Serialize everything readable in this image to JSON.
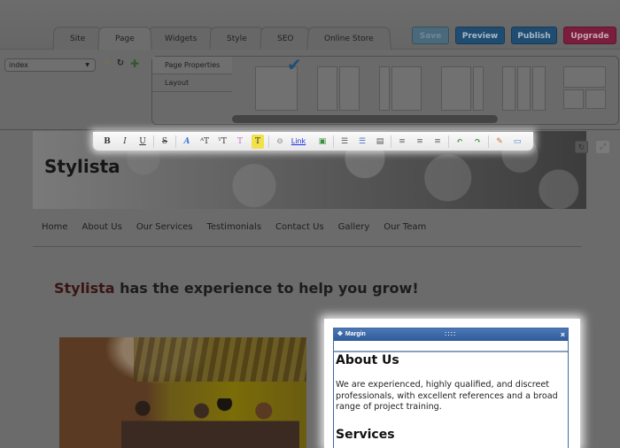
{
  "editor": {
    "tabs": [
      {
        "label": "Site",
        "active": false
      },
      {
        "label": "Page",
        "active": true
      },
      {
        "label": "Widgets",
        "active": false
      },
      {
        "label": "Style",
        "active": false
      },
      {
        "label": "SEO",
        "active": false
      },
      {
        "label": "Online Store",
        "active": false
      }
    ],
    "buttons": {
      "save": "Save",
      "preview": "Preview",
      "publish": "Publish",
      "upgrade": "Upgrade"
    },
    "page_select": {
      "value": "index"
    },
    "page_tools": [
      "pencil-icon",
      "refresh-icon",
      "add-page-icon"
    ],
    "properties_menu": [
      {
        "label": "Page Properties",
        "active": true
      },
      {
        "label": "Layout",
        "active": false
      }
    ],
    "layouts": [
      {
        "name": "single-column",
        "selected": true
      },
      {
        "name": "two-equal-columns",
        "selected": false
      },
      {
        "name": "narrow-left-wide-right",
        "selected": false
      },
      {
        "name": "wide-left-narrow-right",
        "selected": false
      },
      {
        "name": "three-columns",
        "selected": false
      },
      {
        "name": "header-two-columns",
        "selected": false
      }
    ]
  },
  "format_toolbar": {
    "groups": [
      [
        {
          "name": "bold",
          "glyph": "B"
        },
        {
          "name": "italic",
          "glyph": "I"
        },
        {
          "name": "underline",
          "glyph": "U"
        }
      ],
      [
        {
          "name": "strikethrough",
          "glyph": "S"
        }
      ],
      [
        {
          "name": "font",
          "glyph": "A"
        },
        {
          "name": "font-size",
          "glyph": "ᴬT"
        },
        {
          "name": "text-size",
          "glyph": "ᵀT"
        },
        {
          "name": "text-color",
          "glyph": "T"
        },
        {
          "name": "highlight",
          "glyph": "T"
        }
      ],
      [
        {
          "name": "unlink",
          "glyph": "⊖"
        },
        {
          "name": "link",
          "glyph": "Link"
        },
        {
          "name": "insert-image",
          "glyph": "▣"
        }
      ],
      [
        {
          "name": "numbered-list",
          "glyph": "☰"
        },
        {
          "name": "bullet-list",
          "glyph": "☰"
        },
        {
          "name": "indent",
          "glyph": "▤"
        }
      ],
      [
        {
          "name": "align-left",
          "glyph": "≡"
        },
        {
          "name": "align-center",
          "glyph": "≡"
        },
        {
          "name": "align-right",
          "glyph": "≡"
        }
      ],
      [
        {
          "name": "undo",
          "glyph": "↶"
        },
        {
          "name": "redo",
          "glyph": "↷"
        }
      ],
      [
        {
          "name": "clear-format",
          "glyph": "✎"
        },
        {
          "name": "html-source",
          "glyph": "▭"
        }
      ]
    ]
  },
  "site": {
    "title": "Stylista",
    "nav": [
      "Home",
      "About Us",
      "Our Services",
      "Testimonials",
      "Contact Us",
      "Gallery",
      "Our Team"
    ],
    "headline": {
      "brand": "Stylista",
      "rest": " has the experience to help you grow!"
    },
    "photo_alt": "Team meeting in office with yellow wall"
  },
  "text_widget": {
    "bar_label": "Margin",
    "grip": "::::",
    "close": "×",
    "heading1": "About Us",
    "paragraph": "We are experienced, highly qualified, and discreet professionals, with excellent references and a broad range of project training.",
    "heading2": "Services"
  },
  "colors": {
    "brand_text": "#3b1414",
    "margin_bar": "#3a66a8",
    "preview_btn": "#1f4d72",
    "upgrade_btn": "#7b1e3d",
    "checkmark": "#1f4f77"
  }
}
